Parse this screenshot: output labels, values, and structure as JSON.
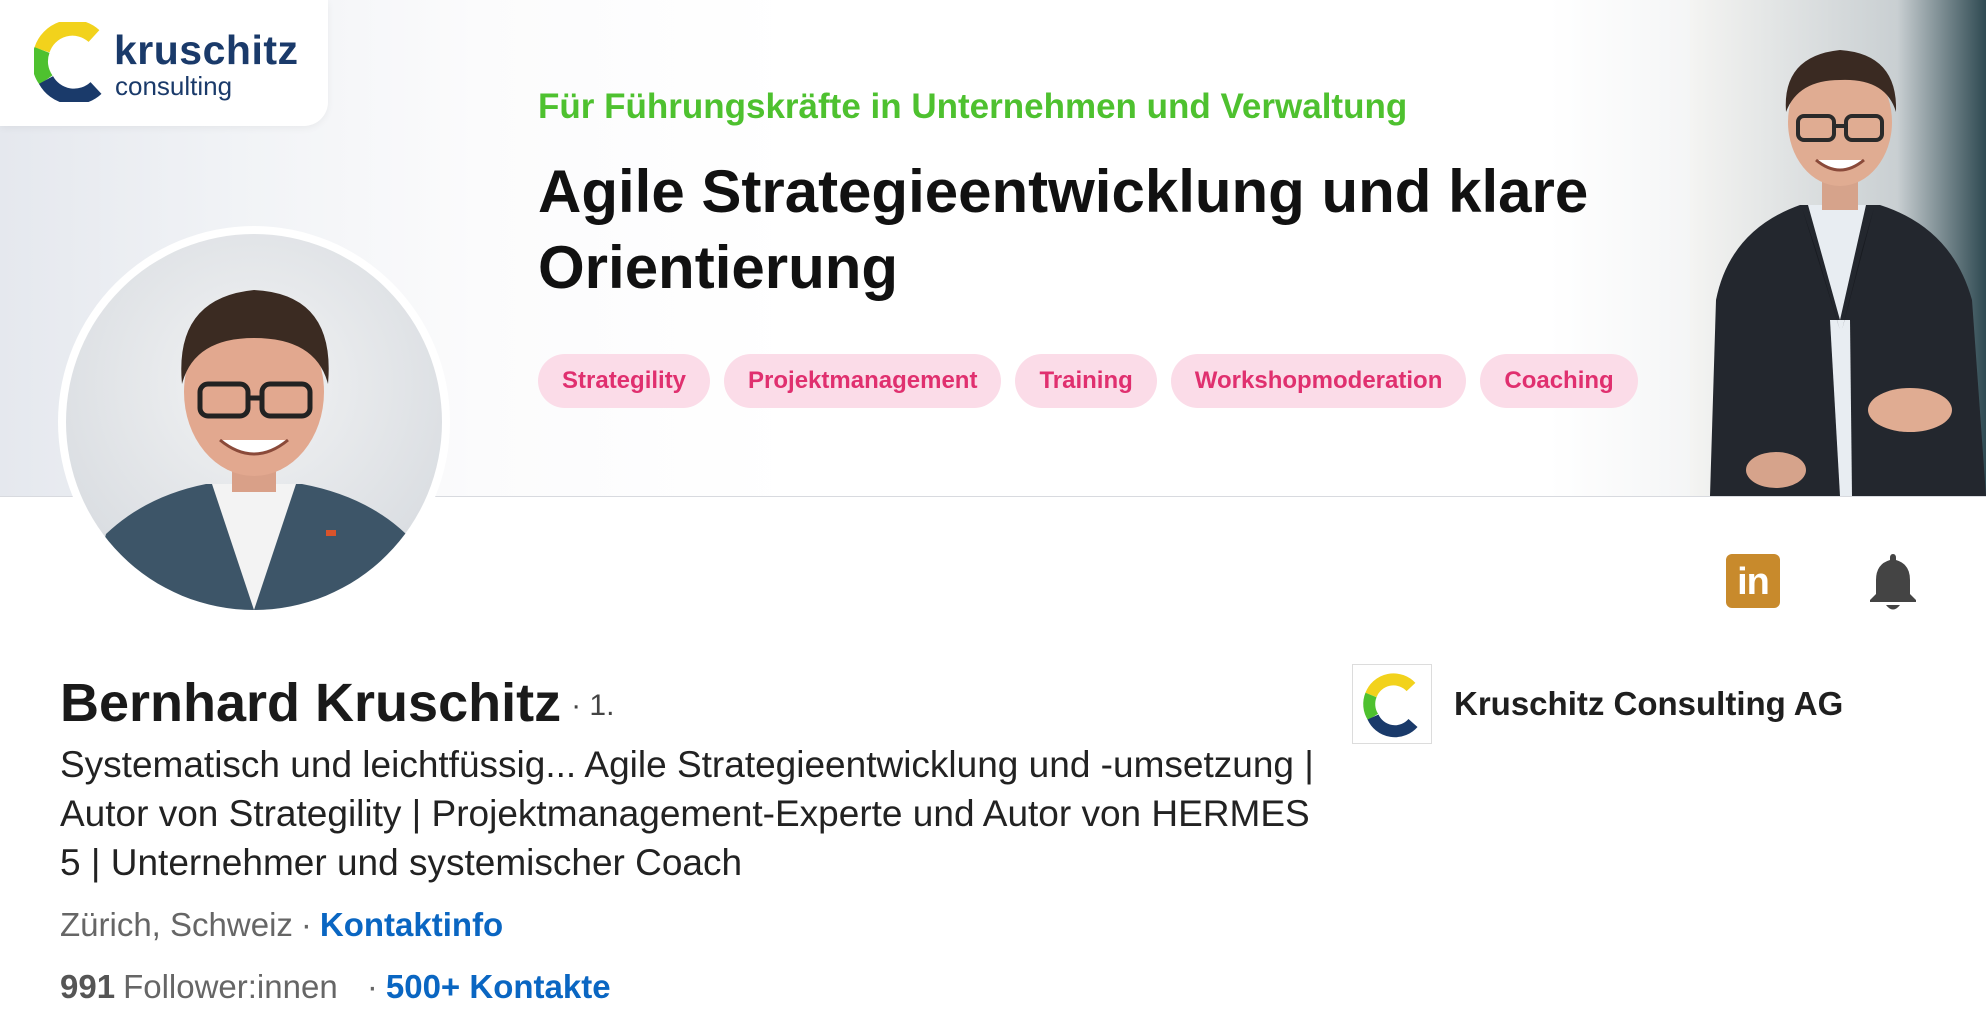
{
  "banner": {
    "logo_word": "kruschitz",
    "logo_sub": "consulting",
    "kicker": "Für Führungskräfte in Unternehmen und Verwaltung",
    "headline_line1": "Agile Strategieentwicklung und klare",
    "headline_line2": "Orientierung",
    "tags": [
      "Strategility",
      "Projektmanagement",
      "Training",
      "Workshopmoderation",
      "Coaching"
    ]
  },
  "actions": {
    "linkedin_glyph": "in",
    "icons": [
      "linkedin-icon",
      "bell-icon"
    ]
  },
  "profile": {
    "name": "Bernhard Kruschitz",
    "degree": "· 1.",
    "headline": "Systematisch und leichtfüssig... Agile Strategieentwicklung und -umsetzung | Autor von Strategility | Projektmanagement-Experte und Autor von HERMES 5 | Unternehmer und systemischer Coach",
    "location": "Zürich, Schweiz",
    "separator": "·",
    "contact_link": "Kontaktinfo",
    "followers_count": "991",
    "followers_label": "Follower:innen",
    "connections_link": "500+ Kontakte"
  },
  "company": {
    "name": "Kruschitz Consulting AG"
  },
  "colors": {
    "kicker_green": "#4ec12f",
    "tag_bg": "#fbdce8",
    "tag_text": "#e0306f",
    "link_blue": "#0a66c2",
    "linkedin_badge": "#c88a2c",
    "logo_navy": "#1a3a6a",
    "logo_yellow": "#f2d21c",
    "logo_green": "#4ec12f"
  }
}
